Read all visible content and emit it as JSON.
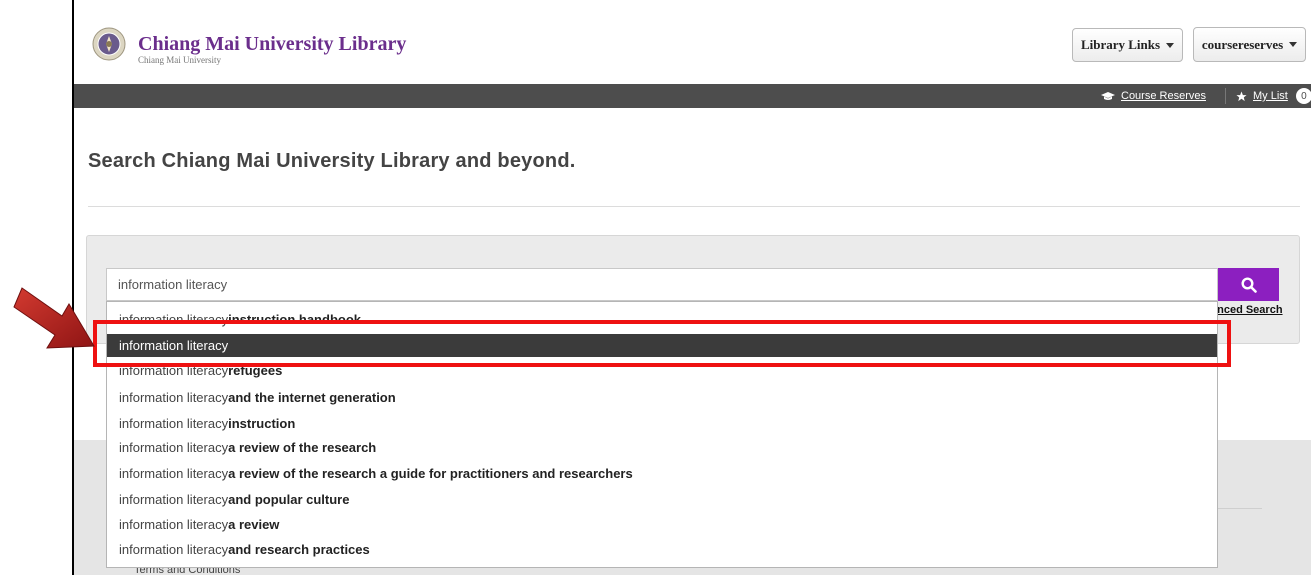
{
  "header": {
    "brand_title": "Chiang Mai University Library",
    "brand_subtitle": "Chiang Mai University",
    "library_links_label": "Library Links",
    "account_label": "coursereserves"
  },
  "nav": {
    "course_reserves": "Course Reserves",
    "my_list": "My List",
    "my_list_count": "0"
  },
  "main": {
    "heading": "Search Chiang Mai University Library and beyond."
  },
  "search": {
    "value": "information literacy",
    "advanced_label": "Advanced Search",
    "advanced_visible": "anced Search"
  },
  "suggestions": [
    {
      "prefix": "information literacy ",
      "suffix": "instruction handbook"
    },
    {
      "prefix": "information literacy",
      "suffix": "",
      "active": true
    },
    {
      "prefix": "information literacy ",
      "suffix": "refugees"
    },
    {
      "prefix": "information literacy ",
      "suffix": "and the internet generation"
    },
    {
      "prefix": "information literacy ",
      "suffix": "instruction"
    },
    {
      "prefix": "information literacy ",
      "suffix": "a review of the research"
    },
    {
      "prefix": "information literacy ",
      "suffix": "a review of the research a guide for practitioners and researchers"
    },
    {
      "prefix": "information literacy ",
      "suffix": "and popular culture"
    },
    {
      "prefix": "information literacy ",
      "suffix": "a review"
    },
    {
      "prefix": "information literacy ",
      "suffix": "and research practices"
    }
  ],
  "footer": {
    "terms": "Terms and Conditions"
  },
  "colors": {
    "brand_purple": "#6b2e8c",
    "search_button": "#8c1fc0",
    "navbar": "#4d4d4d",
    "highlight": "#ee1111",
    "arrow": "#b01c1c"
  },
  "icons": [
    "logo-emblem-icon",
    "graduation-cap-icon",
    "star-icon",
    "search-icon",
    "pointer-arrow-icon",
    "caret-down-icon"
  ]
}
